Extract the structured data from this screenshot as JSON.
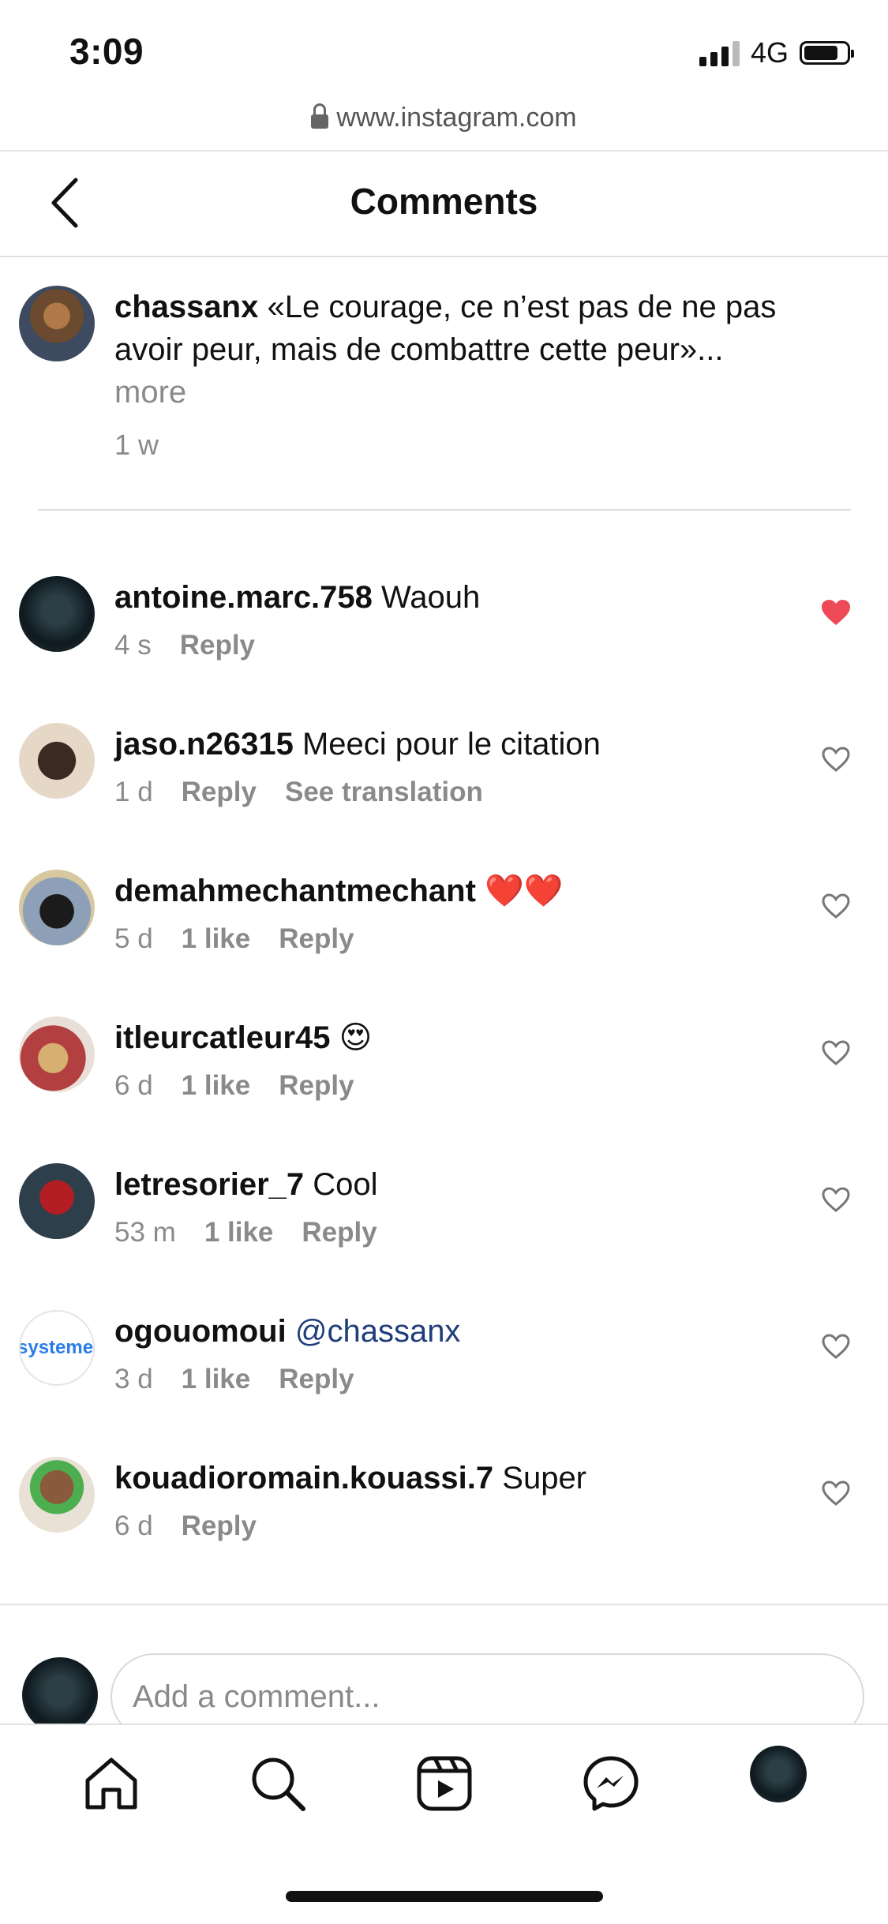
{
  "status_bar": {
    "time": "3:09",
    "network": "4G"
  },
  "browser": {
    "url": "www.instagram.com"
  },
  "header": {
    "title": "Comments"
  },
  "caption": {
    "username": "chassanx",
    "text": "«Le courage, ce n’est pas de ne pas avoir peur, mais de combattre cette peur»...",
    "more": "more",
    "time": "1 w"
  },
  "comments": [
    {
      "username": "antoine.marc.758",
      "text": "Waouh",
      "time": "4 s",
      "reply": "Reply",
      "liked": true
    },
    {
      "username": "jaso.n26315",
      "text": "Meeci pour le citation",
      "time": "1 d",
      "reply": "Reply",
      "translation": "See translation",
      "liked": false
    },
    {
      "username": "demahmechantmechant",
      "text": "❤️❤️",
      "time": "5 d",
      "likes": "1 like",
      "reply": "Reply",
      "liked": false
    },
    {
      "username": "itleurcatleur45",
      "text": "😍",
      "time": "6 d",
      "likes": "1 like",
      "reply": "Reply",
      "liked": false
    },
    {
      "username": "letresorier_7",
      "text": "Cool",
      "time": "53 m",
      "likes": "1 like",
      "reply": "Reply",
      "liked": false
    },
    {
      "username": "ogouomoui",
      "text": "@chassanx",
      "time": "3 d",
      "likes": "1 like",
      "reply": "Reply",
      "liked": false,
      "avatar_text": "systeme"
    },
    {
      "username": "kouadioromain.kouassi.7",
      "text": "Super",
      "time": "6 d",
      "reply": "Reply",
      "liked": false
    }
  ],
  "compose": {
    "placeholder": "Add a comment..."
  },
  "nav": [
    "home-icon",
    "search-icon",
    "reels-icon",
    "messenger-icon",
    "profile-avatar"
  ],
  "colors": {
    "like_red": "#ed4956",
    "text_gray": "#8a8a8a",
    "mention_blue": "#1f3d7a"
  }
}
